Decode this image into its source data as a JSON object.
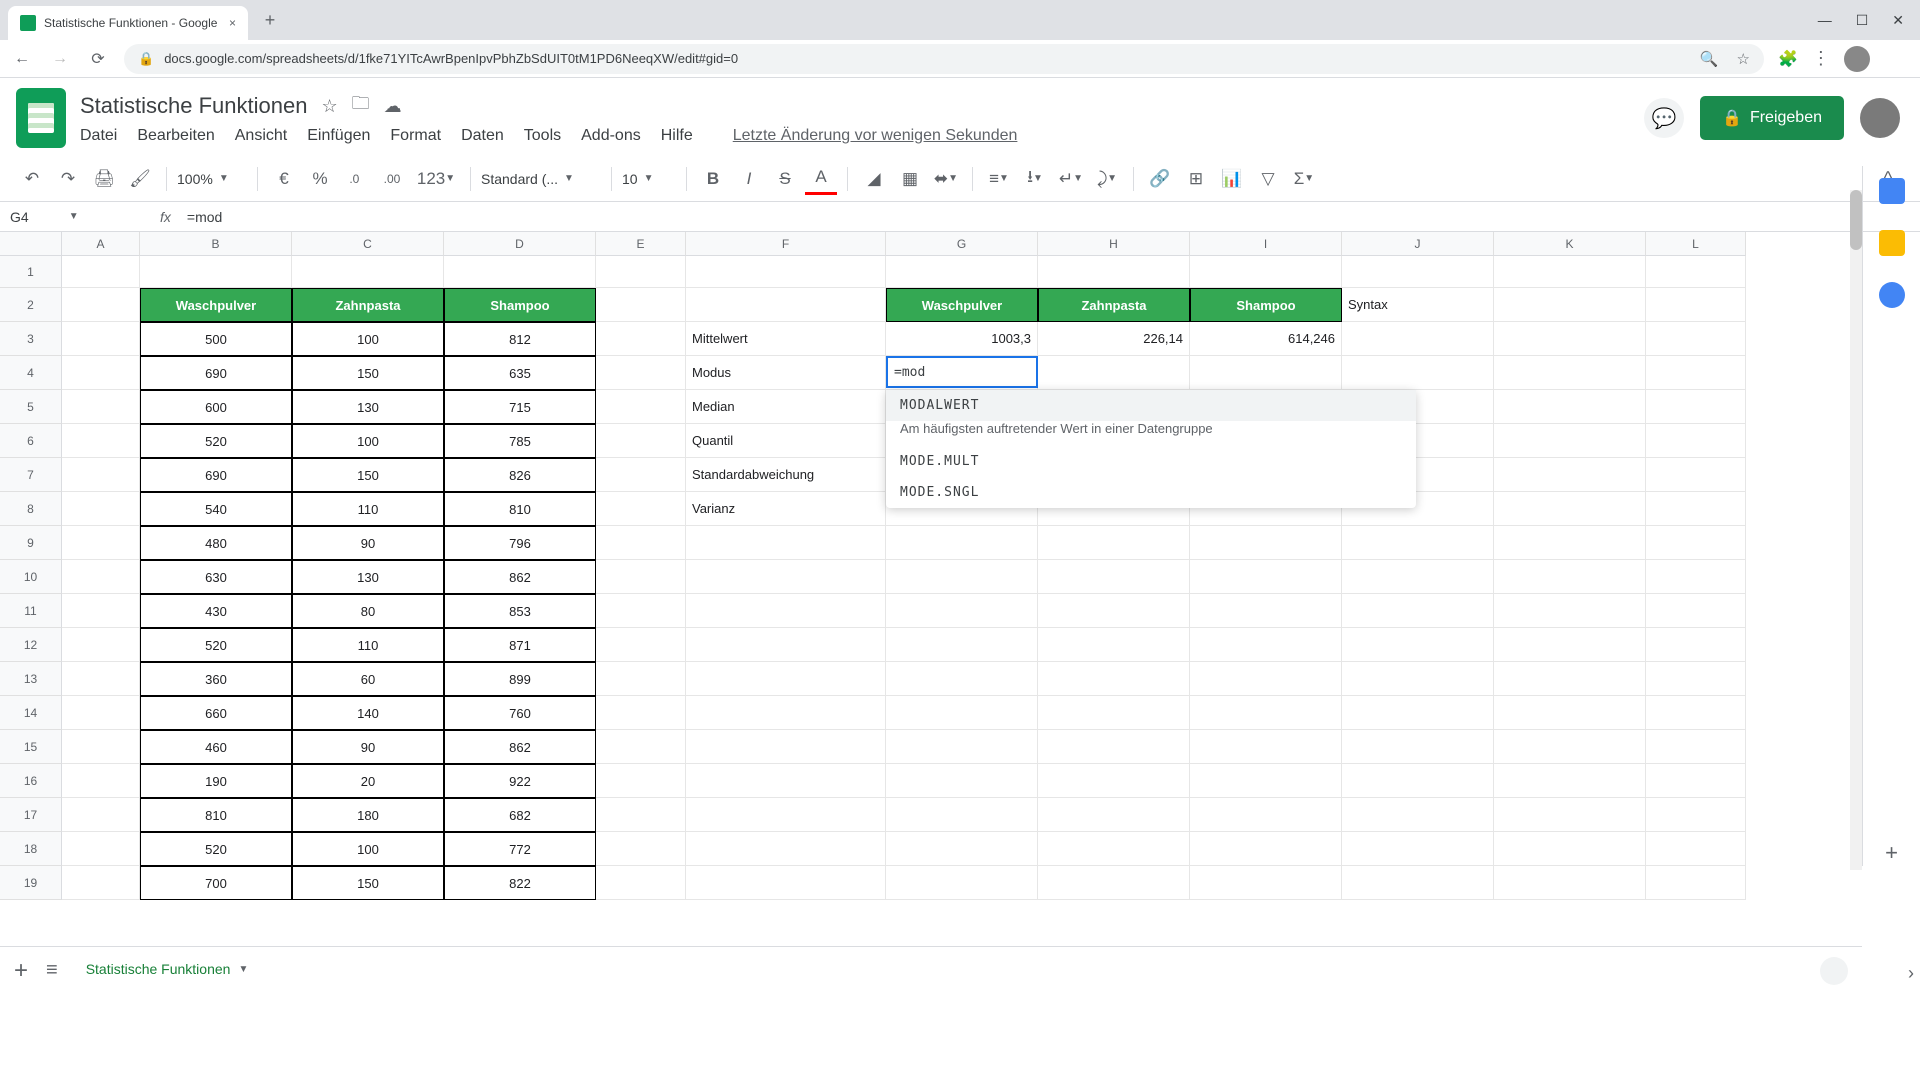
{
  "browser": {
    "tab_title": "Statistische Funktionen - Google",
    "url": "docs.google.com/spreadsheets/d/1fke71YITcAwrBpenIpvPbhZbSdUIT0tM1PD6NeeqXW/edit#gid=0"
  },
  "doc": {
    "name": "Statistische Funktionen",
    "last_mod": "Letzte Änderung vor wenigen Sekunden",
    "share": "Freigeben"
  },
  "menu": {
    "datei": "Datei",
    "bearbeiten": "Bearbeiten",
    "ansicht": "Ansicht",
    "einfuegen": "Einfügen",
    "format": "Format",
    "daten": "Daten",
    "tools": "Tools",
    "addons": "Add-ons",
    "hilfe": "Hilfe"
  },
  "toolbar": {
    "zoom": "100%",
    "currency": "€",
    "percent": "%",
    "dec_dec": ".0",
    "dec_inc": ".00",
    "numfmt": "123",
    "font": "Standard (...",
    "fontsize": "10"
  },
  "namebox": {
    "cell": "G4",
    "formula": "=mod"
  },
  "colheaders": [
    "A",
    "B",
    "C",
    "D",
    "E",
    "F",
    "G",
    "H",
    "I",
    "J",
    "K",
    "L"
  ],
  "rownums": [
    "1",
    "2",
    "3",
    "4",
    "5",
    "6",
    "7",
    "8",
    "9",
    "10",
    "11",
    "12",
    "13",
    "14",
    "15",
    "16",
    "17",
    "18",
    "19"
  ],
  "colwidths": {
    "A": 78,
    "B": 152,
    "C": 152,
    "D": 152,
    "E": 90,
    "F": 200,
    "G": 152,
    "H": 152,
    "I": 152,
    "J": 152,
    "K": 152,
    "L": 100
  },
  "green_header": {
    "colors": {
      "bg": "#34a853"
    }
  },
  "data_headers1": {
    "B": "Waschpulver",
    "C": "Zahnpasta",
    "D": "Shampoo"
  },
  "data_headers2": {
    "G": "Waschpulver",
    "H": "Zahnpasta",
    "I": "Shampoo",
    "J": "Syntax"
  },
  "labels": {
    "F3": "Mittelwert",
    "F4": "Modus",
    "F5": "Median",
    "F6": "Quantil",
    "F7": "Standardabweichung",
    "F8": "Varianz"
  },
  "results": {
    "G3": "1003,3",
    "H3": "226,14",
    "I3": "614,246"
  },
  "active": {
    "G4": "=mod"
  },
  "tabledata": [
    {
      "B": "500",
      "C": "100",
      "D": "812"
    },
    {
      "B": "690",
      "C": "150",
      "D": "635"
    },
    {
      "B": "600",
      "C": "130",
      "D": "715"
    },
    {
      "B": "520",
      "C": "100",
      "D": "785"
    },
    {
      "B": "690",
      "C": "150",
      "D": "826"
    },
    {
      "B": "540",
      "C": "110",
      "D": "810"
    },
    {
      "B": "480",
      "C": "90",
      "D": "796"
    },
    {
      "B": "630",
      "C": "130",
      "D": "862"
    },
    {
      "B": "430",
      "C": "80",
      "D": "853"
    },
    {
      "B": "520",
      "C": "110",
      "D": "871"
    },
    {
      "B": "360",
      "C": "60",
      "D": "899"
    },
    {
      "B": "660",
      "C": "140",
      "D": "760"
    },
    {
      "B": "460",
      "C": "90",
      "D": "862"
    },
    {
      "B": "190",
      "C": "20",
      "D": "922"
    },
    {
      "B": "810",
      "C": "180",
      "D": "682"
    },
    {
      "B": "520",
      "C": "100",
      "D": "772"
    },
    {
      "B": "700",
      "C": "150",
      "D": "822"
    }
  ],
  "suggest": {
    "items": [
      {
        "name": "MODALWERT",
        "desc": "Am häufigsten auftretender Wert in einer Datengruppe"
      },
      {
        "name": "MODE.MULT"
      },
      {
        "name": "MODE.SNGL"
      }
    ]
  },
  "sheettab": "Statistische Funktionen"
}
